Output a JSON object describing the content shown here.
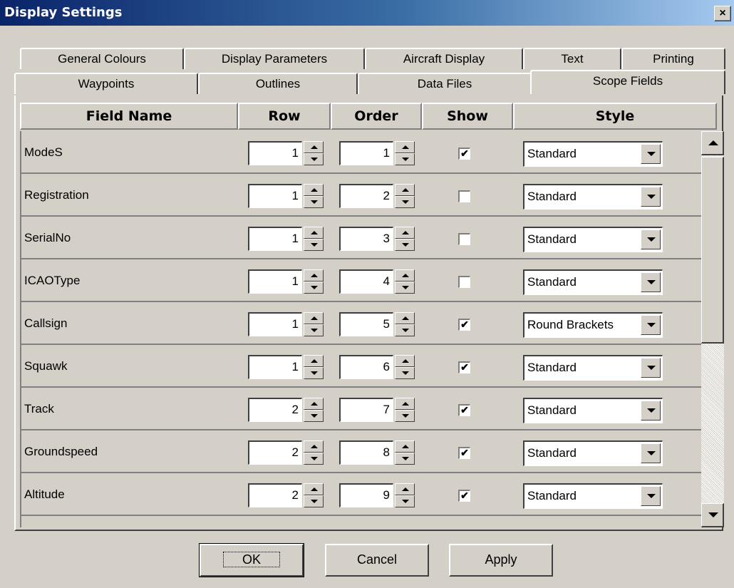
{
  "window": {
    "title": "Display Settings",
    "close_glyph": "×"
  },
  "tabs": {
    "row1": [
      "General Colours",
      "Display Parameters",
      "Aircraft Display",
      "Text",
      "Printing"
    ],
    "row2": [
      "Waypoints",
      "Outlines",
      "Data Files",
      "Scope Fields"
    ],
    "active": "Scope Fields"
  },
  "columns": [
    "Field Name",
    "Row",
    "Order",
    "Show",
    "Style"
  ],
  "rows": [
    {
      "name": "ModeS",
      "row": "1",
      "order": "1",
      "show": true,
      "style": "Standard"
    },
    {
      "name": "Registration",
      "row": "1",
      "order": "2",
      "show": false,
      "style": "Standard"
    },
    {
      "name": "SerialNo",
      "row": "1",
      "order": "3",
      "show": false,
      "style": "Standard"
    },
    {
      "name": "ICAOType",
      "row": "1",
      "order": "4",
      "show": false,
      "style": "Standard"
    },
    {
      "name": "Callsign",
      "row": "1",
      "order": "5",
      "show": true,
      "style": "Round Brackets"
    },
    {
      "name": "Squawk",
      "row": "1",
      "order": "6",
      "show": true,
      "style": "Standard"
    },
    {
      "name": "Track",
      "row": "2",
      "order": "7",
      "show": true,
      "style": "Standard"
    },
    {
      "name": "Groundspeed",
      "row": "2",
      "order": "8",
      "show": true,
      "style": "Standard"
    },
    {
      "name": "Altitude",
      "row": "2",
      "order": "9",
      "show": true,
      "style": "Standard"
    }
  ],
  "buttons": {
    "ok": "OK",
    "cancel": "Cancel",
    "apply": "Apply"
  },
  "icons": {
    "spin_up": "up-arrow-icon",
    "spin_down": "down-arrow-icon",
    "dropdown": "chevron-down-icon",
    "check": "checkmark-icon"
  },
  "colors": {
    "title_start": "#0a246a",
    "title_end": "#a6caf0",
    "face": "#d4d0c8"
  }
}
